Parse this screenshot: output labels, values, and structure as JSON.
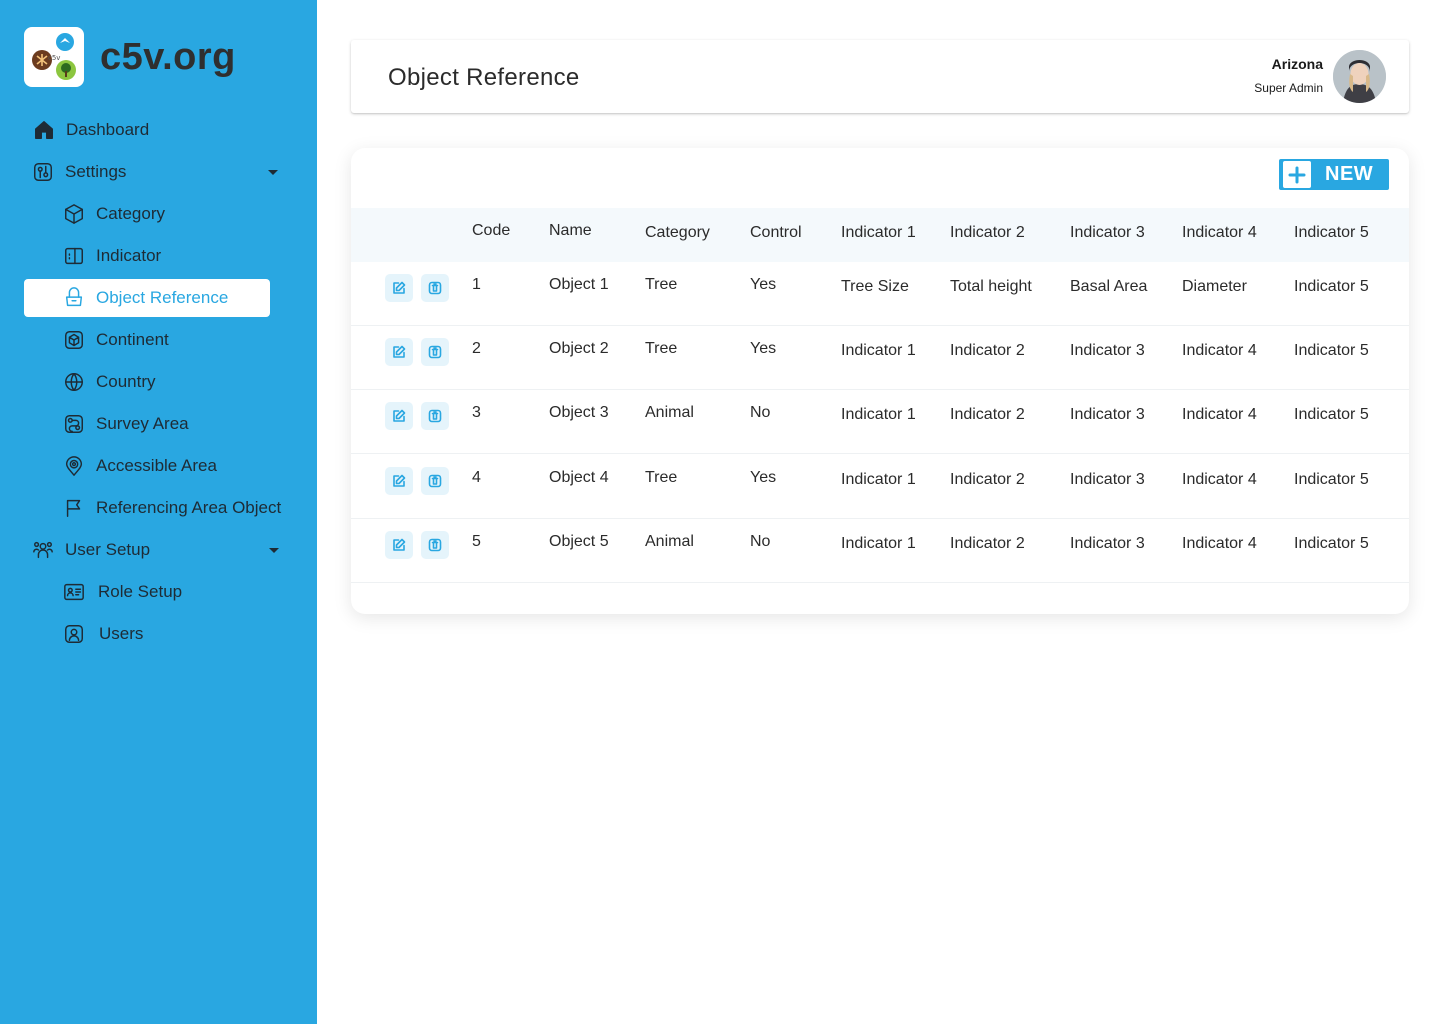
{
  "app": {
    "brand": "c5v.org",
    "logo_text": "c5v",
    "accent": "#29a7e1"
  },
  "sidebar": {
    "dashboard": "Dashboard",
    "settings": "Settings",
    "category": "Category",
    "indicator": "Indicator",
    "object_reference": "Object Reference",
    "continent": "Continent",
    "country": "Country",
    "survey_area": "Survey Area",
    "accessible_area": "Accessible Area",
    "referencing_area_object": "Referencing Area Object",
    "user_setup": "User Setup",
    "role_setup": "Role Setup",
    "users": "Users"
  },
  "header": {
    "title": "Object Reference",
    "user_name": "Arizona",
    "user_role": "Super Admin"
  },
  "toolbar": {
    "new_label": "NEW"
  },
  "table": {
    "columns": {
      "code": "Code",
      "name": "Name",
      "category": "Category",
      "control": "Control",
      "ind1": "Indicator 1",
      "ind2": "Indicator 2",
      "ind3": "Indicator 3",
      "ind4": "Indicator 4",
      "ind5": "Indicator 5"
    },
    "rows": [
      {
        "code": "1",
        "name": "Object 1",
        "category": "Tree",
        "control": "Yes",
        "ind1": "Tree Size",
        "ind2": "Total height",
        "ind3": "Basal Area",
        "ind4": "Diameter",
        "ind5": "Indicator 5"
      },
      {
        "code": "2",
        "name": "Object 2",
        "category": "Tree",
        "control": "Yes",
        "ind1": "Indicator 1",
        "ind2": "Indicator 2",
        "ind3": "Indicator 3",
        "ind4": "Indicator 4",
        "ind5": "Indicator 5"
      },
      {
        "code": "3",
        "name": "Object 3",
        "category": "Animal",
        "control": "No",
        "ind1": "Indicator 1",
        "ind2": "Indicator 2",
        "ind3": "Indicator 3",
        "ind4": "Indicator 4",
        "ind5": "Indicator 5"
      },
      {
        "code": "4",
        "name": "Object 4",
        "category": "Tree",
        "control": "Yes",
        "ind1": "Indicator 1",
        "ind2": "Indicator 2",
        "ind3": "Indicator 3",
        "ind4": "Indicator 4",
        "ind5": "Indicator 5"
      },
      {
        "code": "5",
        "name": "Object 5",
        "category": "Animal",
        "control": "No",
        "ind1": "Indicator 1",
        "ind2": "Indicator 2",
        "ind3": "Indicator 3",
        "ind4": "Indicator 4",
        "ind5": "Indicator 5"
      }
    ]
  }
}
